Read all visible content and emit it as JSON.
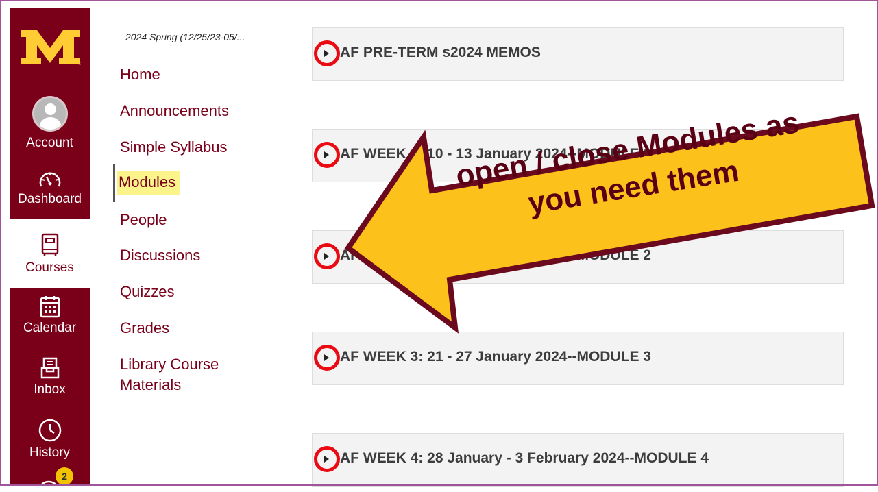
{
  "global_nav": {
    "logo_text": "M",
    "items": [
      {
        "label": "Account",
        "icon": "avatar-icon"
      },
      {
        "label": "Dashboard",
        "icon": "speedometer-icon"
      },
      {
        "label": "Courses",
        "icon": "book-icon",
        "active": true
      },
      {
        "label": "Calendar",
        "icon": "calendar-icon"
      },
      {
        "label": "Inbox",
        "icon": "inbox-icon"
      },
      {
        "label": "History",
        "icon": "clock-icon"
      }
    ],
    "help_badge": "2"
  },
  "course_nav": {
    "term": "2024 Spring (12/25/23-05/...",
    "links": [
      "Home",
      "Announcements",
      "Simple Syllabus",
      "Modules",
      "People",
      "Discussions",
      "Quizzes",
      "Grades",
      "Library Course",
      "Materials"
    ],
    "active": "Modules"
  },
  "modules": [
    {
      "title": "AF PRE-TERM s2024 MEMOS"
    },
    {
      "title": "AF WEEK 1: 10 - 13 January 2024--MODULE 1"
    },
    {
      "title": "AF WEEK 2: 14 - 20 January 2024--MODULE 2"
    },
    {
      "title": "AF WEEK 3: 21 - 27 January 2024--MODULE 3"
    },
    {
      "title": "AF WEEK 4: 28 January - 3 February 2024--MODULE 4"
    }
  ],
  "callout": {
    "line1": "open / close Modules as",
    "line2": "you need them",
    "fill": "#fcc21b",
    "stroke": "#6b0a1e"
  },
  "colors": {
    "brand": "#7a0019",
    "gold": "#ffcc33",
    "highlight": "#fbf48a",
    "toggle_ring": "#ea0b12"
  }
}
